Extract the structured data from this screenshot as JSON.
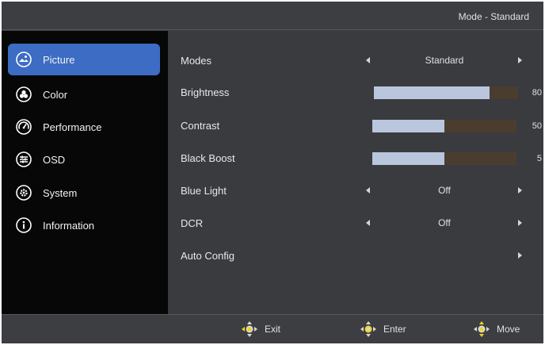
{
  "header": {
    "mode_label": "Mode - Standard"
  },
  "sidebar": {
    "items": [
      {
        "label": "Picture",
        "icon": "picture-icon",
        "active": true
      },
      {
        "label": "Color",
        "icon": "color-icon",
        "active": false
      },
      {
        "label": "Performance",
        "icon": "performance-icon",
        "active": false
      },
      {
        "label": "OSD",
        "icon": "osd-icon",
        "active": false
      },
      {
        "label": "System",
        "icon": "system-icon",
        "active": false
      },
      {
        "label": "Information",
        "icon": "information-icon",
        "active": false
      }
    ]
  },
  "settings": {
    "modes": {
      "label": "Modes",
      "value": "Standard"
    },
    "brightness": {
      "label": "Brightness",
      "value": "80",
      "level": 0.8
    },
    "contrast": {
      "label": "Contrast",
      "value": "50",
      "level": 0.5
    },
    "black_boost": {
      "label": "Black Boost",
      "value": "5",
      "level": 0.5
    },
    "blue_light": {
      "label": "Blue Light",
      "value": "Off"
    },
    "dcr": {
      "label": "DCR",
      "value": "Off"
    },
    "auto_config": {
      "label": "Auto Config"
    }
  },
  "footer": {
    "exit_label": "Exit",
    "enter_label": "Enter",
    "move_label": "Move"
  },
  "colors": {
    "accent": "#3c6cc3",
    "slider_fill": "#b9c6de",
    "slider_track": "#4a3d2f",
    "nav_yellow": "#f3d21a"
  }
}
